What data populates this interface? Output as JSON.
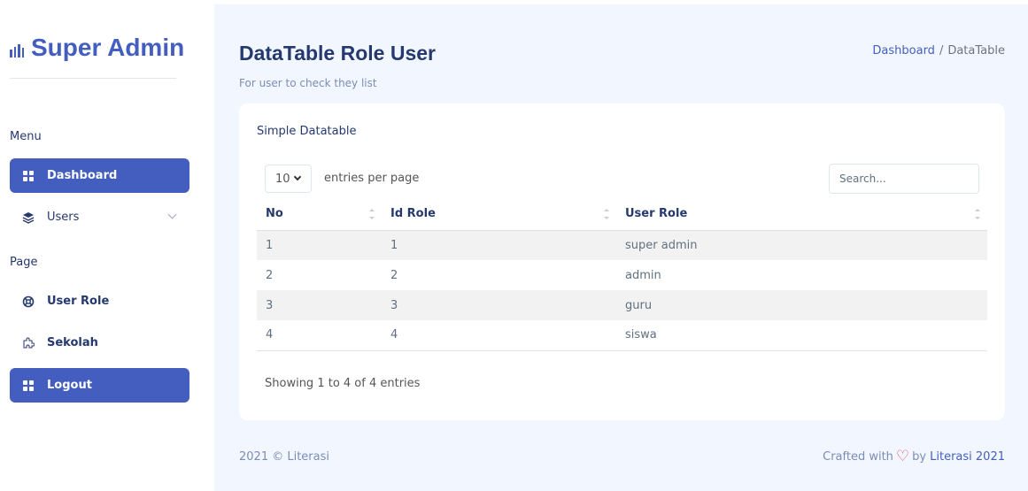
{
  "brand": {
    "title": "Super Admin"
  },
  "sidebar": {
    "menu_title": "Menu",
    "page_title": "Page",
    "items": [
      {
        "label": "Dashboard",
        "icon": "grid-icon",
        "active": true
      },
      {
        "label": "Users",
        "icon": "stack-icon",
        "has_submenu": true
      },
      {
        "label": "User Role",
        "icon": "life-ring-icon"
      },
      {
        "label": "Sekolah",
        "icon": "puzzle-icon"
      },
      {
        "label": "Logout",
        "icon": "grid-icon",
        "active": true
      }
    ]
  },
  "header": {
    "title": "DataTable Role User",
    "subtitle": "For user to check they list",
    "breadcrumb": [
      "Dashboard",
      "DataTable"
    ]
  },
  "card": {
    "title": "Simple Datatable",
    "per_page_value": "10",
    "per_page_label": "entries per page",
    "search_placeholder": "Search...",
    "columns": [
      "No",
      "Id Role",
      "User Role"
    ],
    "rows": [
      [
        "1",
        "1",
        "super admin"
      ],
      [
        "2",
        "2",
        "admin"
      ],
      [
        "3",
        "3",
        "guru"
      ],
      [
        "4",
        "4",
        "siswa"
      ]
    ],
    "info": "Showing 1 to 4 of 4 entries"
  },
  "footer": {
    "left": "2021 © Literasi",
    "crafted": "Crafted with",
    "by": "by",
    "link": "Literasi 2021"
  },
  "colors": {
    "accent": "#435ebe",
    "bg": "#f2f7ff",
    "heart": "#e04b6b"
  }
}
